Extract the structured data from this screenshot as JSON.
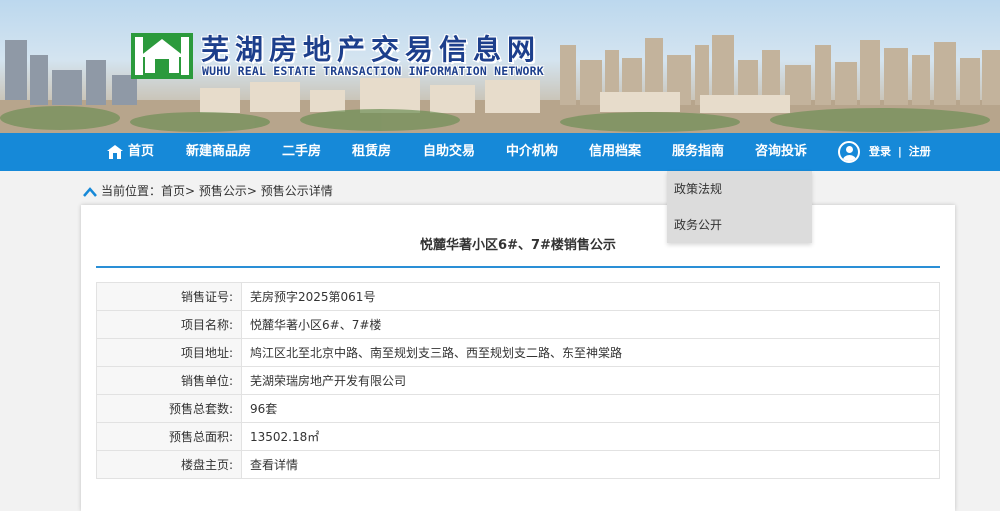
{
  "header": {
    "title": "芜湖房地产交易信息网",
    "subtitle": "WUHU REAL ESTATE TRANSACTION INFORMATION NETWORK"
  },
  "nav": {
    "items": [
      {
        "label": "首页"
      },
      {
        "label": "新建商品房"
      },
      {
        "label": "二手房"
      },
      {
        "label": "租赁房"
      },
      {
        "label": "自助交易"
      },
      {
        "label": "中介机构"
      },
      {
        "label": "信用档案"
      },
      {
        "label": "服务指南"
      },
      {
        "label": "咨询投诉"
      }
    ],
    "login": "登录",
    "separator": "|",
    "register": "注册"
  },
  "dropdown": {
    "items": [
      "政策法规",
      "政务公开"
    ]
  },
  "breadcrumb": {
    "prefix": "当前位置：",
    "items": [
      "首页>",
      "预售公示>",
      "预售公示详情"
    ]
  },
  "detail": {
    "title": "悦麓华著小区6#、7#楼销售公示",
    "rows": [
      {
        "key": "销售证号:",
        "value": "芜房预字2025第061号"
      },
      {
        "key": "项目名称:",
        "value": "悦麓华著小区6#、7#楼"
      },
      {
        "key": "项目地址:",
        "value": "鸠江区北至北京中路、南至规划支三路、西至规划支二路、东至神棠路"
      },
      {
        "key": "销售单位:",
        "value": "芜湖荣瑞房地产开发有限公司"
      },
      {
        "key": "预售总套数:",
        "value": "96套"
      },
      {
        "key": "预售总面积:",
        "value": "13502.18㎡"
      },
      {
        "key": "楼盘主页:",
        "value": "查看详情"
      }
    ]
  },
  "colors": {
    "nav": "#1689d8",
    "accent_line": "#2a8fd6",
    "title_blue": "#1d3f8c"
  }
}
